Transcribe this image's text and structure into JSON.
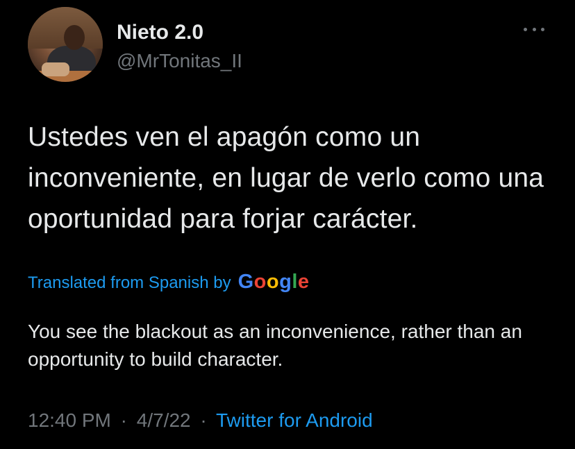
{
  "user": {
    "display_name": "Nieto 2.0",
    "handle": "@MrTonitas_II",
    "avatar_icon": "profile-photo"
  },
  "menu": {
    "icon": "more-horizontal-icon"
  },
  "tweet": {
    "text": "Ustedes ven el apagón como un inconveniente, en lugar de verlo como una oportunidad para forjar carácter."
  },
  "translation": {
    "label": "Translated from Spanish by",
    "provider": "Google",
    "text": "You see the blackout as an inconvenience, rather than an opportunity to build character."
  },
  "meta": {
    "time": "12:40 PM",
    "separator": "·",
    "date": "4/7/22",
    "source": "Twitter for Android"
  },
  "colors": {
    "background": "#000000",
    "text_primary": "#e7e9ea",
    "text_secondary": "#71767b",
    "accent": "#1d9bf0"
  }
}
